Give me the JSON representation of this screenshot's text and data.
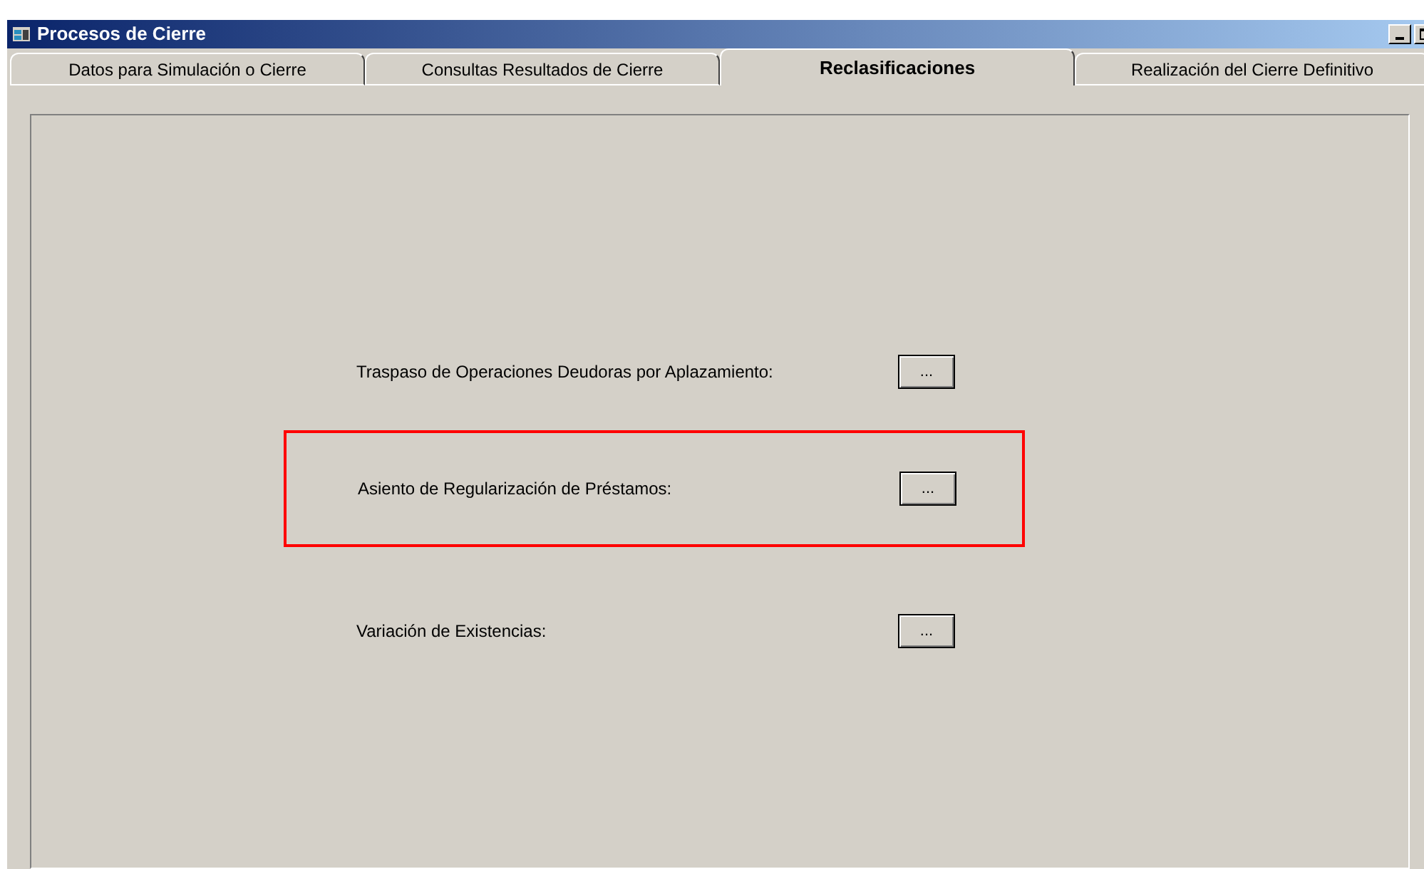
{
  "window": {
    "title": "Procesos de Cierre"
  },
  "tabs": [
    {
      "label": "Datos para Simulación o Cierre",
      "selected": false
    },
    {
      "label": "Consultas Resultados de Cierre",
      "selected": false
    },
    {
      "label": "Reclasificaciones",
      "selected": true
    },
    {
      "label": "Realización del Cierre Definitivo",
      "selected": false
    }
  ],
  "rows": [
    {
      "label": "Traspaso de Operaciones Deudoras por Aplazamiento:",
      "button": "...",
      "highlighted": false
    },
    {
      "label": "Asiento de Regularización de Préstamos:",
      "button": "...",
      "highlighted": true
    },
    {
      "label": "Variación de Existencias:",
      "button": "...",
      "highlighted": false
    }
  ]
}
